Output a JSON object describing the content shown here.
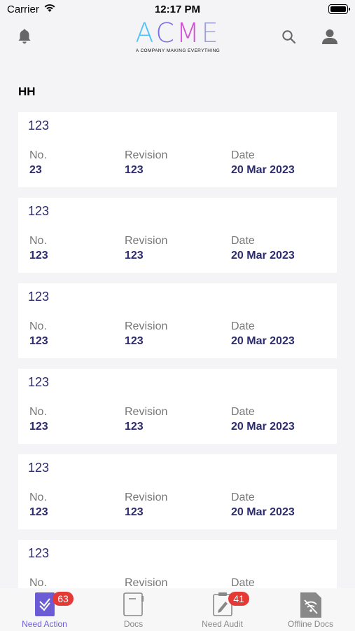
{
  "status_bar": {
    "carrier": "Carrier",
    "time": "12:17 PM"
  },
  "header": {
    "logo_text": "ACME",
    "logo_tagline": "A COMPANY MAKING EVERYTHING",
    "logo_colors": [
      "#4fc3f7",
      "#7c6fe0",
      "#d24fd6",
      "#a0a0d8"
    ],
    "icons": [
      "bell-icon",
      "search-icon",
      "user-icon"
    ]
  },
  "section": {
    "title": "HH"
  },
  "labels": {
    "no": "No.",
    "revision": "Revision",
    "date": "Date"
  },
  "documents": [
    {
      "title": "123",
      "no": "23",
      "revision": "123",
      "date": "20 Mar 2023"
    },
    {
      "title": "123",
      "no": "123",
      "revision": "123",
      "date": "20 Mar 2023"
    },
    {
      "title": "123",
      "no": "123",
      "revision": "123",
      "date": "20 Mar 2023"
    },
    {
      "title": "123",
      "no": "123",
      "revision": "123",
      "date": "20 Mar 2023"
    },
    {
      "title": "123",
      "no": "123",
      "revision": "123",
      "date": "20 Mar 2023"
    },
    {
      "title": "123",
      "no": "",
      "revision": "",
      "date": ""
    }
  ],
  "tabs": [
    {
      "label": "Need Action",
      "badge": "63",
      "icon": "check-list-icon",
      "active": true
    },
    {
      "label": "Docs",
      "badge": "",
      "icon": "notebook-icon",
      "active": false
    },
    {
      "label": "Need Audit",
      "badge": "41",
      "icon": "clipboard-edit-icon",
      "active": false
    },
    {
      "label": "Offline Docs",
      "badge": "",
      "icon": "offline-doc-icon",
      "active": false
    }
  ],
  "colors": {
    "accent": "#6b5cd6",
    "title": "#2c2c6e",
    "badge": "#e53935",
    "background": "#f4f4f6"
  }
}
